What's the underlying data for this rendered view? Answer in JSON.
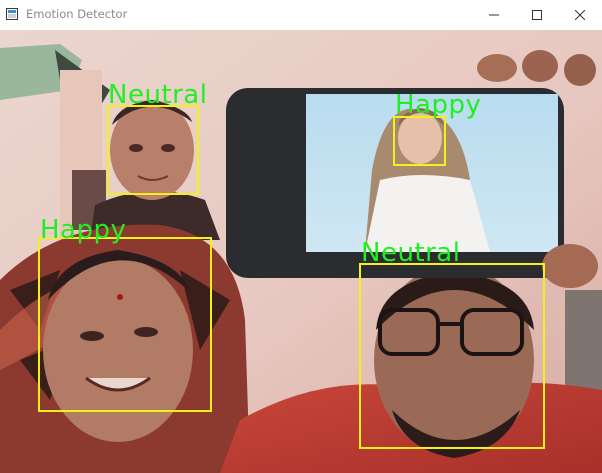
{
  "window": {
    "title": "Emotion Detector",
    "icon": "opencv-window-icon",
    "controls": {
      "minimize_icon": "minimize-icon",
      "maximize_icon": "maximize-icon",
      "close_icon": "close-icon"
    }
  },
  "colors": {
    "box": "#f2f21a",
    "label": "#22ee22"
  },
  "detections": [
    {
      "label": "Neutral"
    },
    {
      "label": "Happy"
    },
    {
      "label": "Happy"
    },
    {
      "label": "Neutral"
    }
  ]
}
